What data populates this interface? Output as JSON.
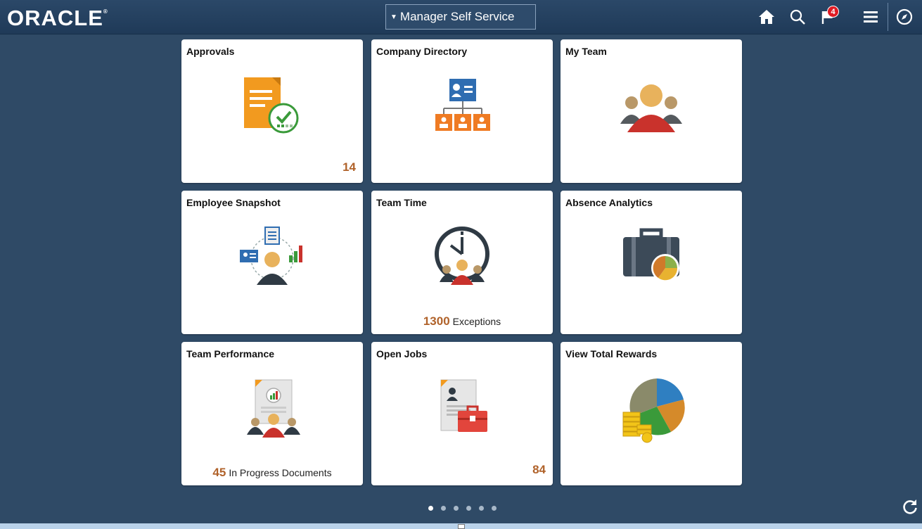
{
  "header": {
    "logo_text": "ORACLE",
    "homepage_selector": "Manager Self Service",
    "notification_count": "4",
    "icons": [
      "home-icon",
      "search-icon",
      "flag-icon",
      "menu-icon",
      "navigator-icon"
    ]
  },
  "tiles": [
    {
      "title": "Approvals",
      "icon": "approvals-document-check-icon",
      "count": "14"
    },
    {
      "title": "Company Directory",
      "icon": "org-chart-icon"
    },
    {
      "title": "My Team",
      "icon": "team-people-icon"
    },
    {
      "title": "Employee Snapshot",
      "icon": "employee-snapshot-icon"
    },
    {
      "title": "Team Time",
      "icon": "clock-team-icon",
      "kpi_value": "1300",
      "kpi_label": "Exceptions"
    },
    {
      "title": "Absence Analytics",
      "icon": "briefcase-pie-icon"
    },
    {
      "title": "Team Performance",
      "icon": "performance-document-team-icon",
      "kpi_value": "45",
      "kpi_label": "In Progress Documents"
    },
    {
      "title": "Open Jobs",
      "icon": "job-resume-briefcase-icon",
      "count": "84"
    },
    {
      "title": "View Total Rewards",
      "icon": "rewards-pie-coins-icon"
    }
  ],
  "pagination": {
    "pages": 6,
    "active": 1
  },
  "colors": {
    "background": "#2f4a66",
    "header": "#1f3a58",
    "count": "#b0622a",
    "tile": "#ffffff"
  }
}
